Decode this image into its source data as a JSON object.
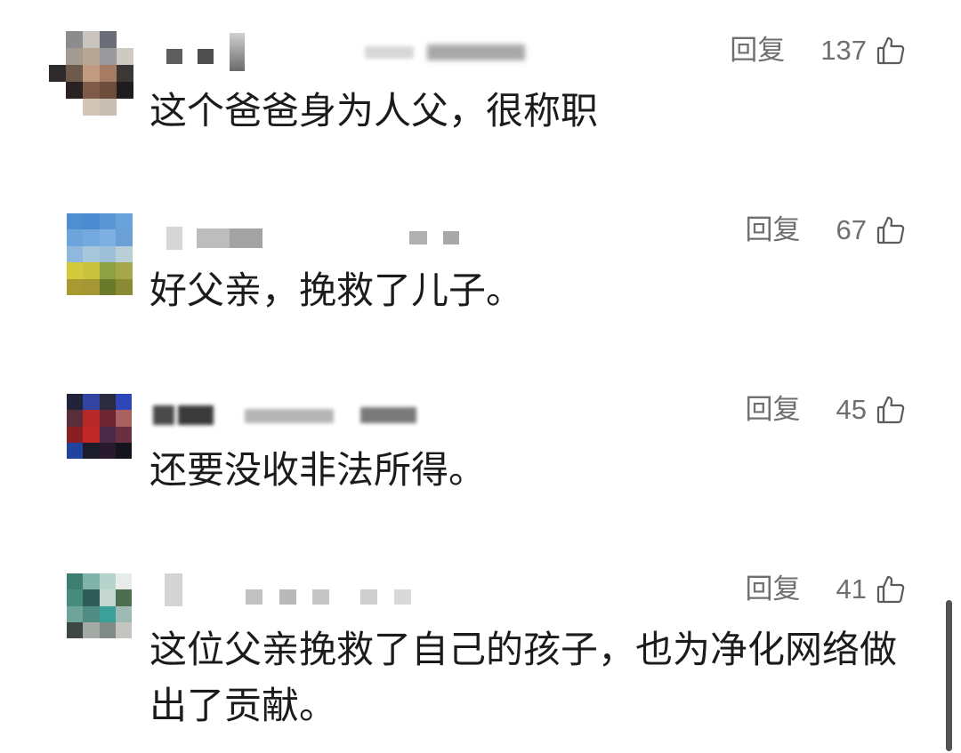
{
  "colors": {
    "background": "#ffffff",
    "text": "#1b1b1b",
    "meta": "#6f6f6f",
    "icon": "#5b5b5b",
    "scrollbar": "#525252"
  },
  "comments": [
    {
      "avatar_mosaic": [
        [
          null,
          "#8c8c8e",
          "#c9c4c0",
          "#6b6d78",
          null
        ],
        [
          null,
          "#a39a91",
          "#b7a595",
          "#9a9a9c",
          "#cfc9c3"
        ],
        [
          "#2e2b2a",
          "#6e5a4d",
          "#c19a82",
          "#a57b63",
          "#3b3735"
        ],
        [
          null,
          "#2a2220",
          "#7d5b48",
          "#6d4e3d",
          "#1e1c1c"
        ],
        [
          null,
          null,
          "#d2c5b8",
          "#c7bdb3",
          null
        ]
      ],
      "reply_label": "回复",
      "like_count": "137",
      "like_icon": "thumbs-up-icon",
      "text": "这个爸爸身为人父，很称职"
    },
    {
      "avatar_mosaic": [
        [
          "#4f8fd0",
          "#4b8cd0",
          "#5a96d6",
          "#6aa2dc"
        ],
        [
          "#6ca4dc",
          "#73a9de",
          "#7db0e0",
          "#6aa0d6"
        ],
        [
          "#8fb9dc",
          "#a9c7da",
          "#9ec0d6",
          "#b8cfd8"
        ],
        [
          "#d4c938",
          "#c9c23c",
          "#8fa044",
          "#a6a64a"
        ],
        [
          "#a89a30",
          "#a59735",
          "#6b7a2a",
          "#8a8a34"
        ]
      ],
      "reply_label": "回复",
      "like_count": "67",
      "like_icon": "thumbs-up-icon",
      "text": "好父亲，挽救了儿子。"
    },
    {
      "avatar_mosaic": [
        [
          "#20233a",
          "#3244a0",
          "#2a2b3c",
          "#2e46b8"
        ],
        [
          "#5a2d3a",
          "#b7282a",
          "#6e2432",
          "#a86060"
        ],
        [
          "#8a1e22",
          "#c02828",
          "#4a2a48",
          "#6a3040"
        ],
        [
          "#2043a0",
          "#1c1c2a",
          "#2a1a2e",
          "#14141c"
        ]
      ],
      "reply_label": "回复",
      "like_count": "45",
      "like_icon": "thumbs-up-icon",
      "text": "还要没收非法所得。"
    },
    {
      "avatar_mosaic": [
        [
          "#3d7f6f",
          "#7fb3aa",
          "#b6d3cc",
          "#e8ece9"
        ],
        [
          "#468c7c",
          "#2f5c57",
          "#c5d5cf",
          "#4e6e50"
        ],
        [
          "#6ea39a",
          "#4e8c84",
          "#3ba097",
          "#9fbab4"
        ],
        [
          "#3e4646",
          "#a3aaa6",
          "#808a86",
          "#c4c4c0"
        ]
      ],
      "reply_label": "回复",
      "like_count": "41",
      "like_icon": "thumbs-up-icon",
      "text": "这位父亲挽救了自己的孩子，也为净化网络做出了贡献。"
    }
  ]
}
